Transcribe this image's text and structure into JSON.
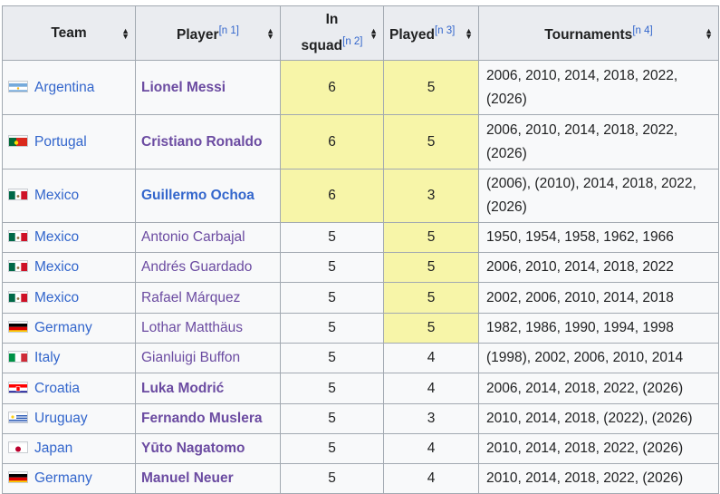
{
  "headers": {
    "team": "Team",
    "player": "Player",
    "player_note": "[n 1]",
    "squad_line1": "In",
    "squad_line2": "squad",
    "squad_note": "[n 2]",
    "played": "Played",
    "played_note": "[n 3]",
    "tournaments": "Tournaments",
    "tournaments_note": "[n 4]"
  },
  "colors": {
    "highlight": "#f7f5a8",
    "link": "#3366cc",
    "visited": "#6b4ba1",
    "header_bg": "#eaecf0"
  },
  "rows": [
    {
      "team": "Argentina",
      "flag": "argentina-flag-icon",
      "player": "Lionel Messi",
      "squad": "6",
      "played": "5",
      "tournaments": "2006, 2010, 2014, 2018, 2022, (2026)"
    },
    {
      "team": "Portugal",
      "flag": "portugal-flag-icon",
      "player": "Cristiano Ronaldo",
      "squad": "6",
      "played": "5",
      "tournaments": "2006, 2010, 2014, 2018, 2022, (2026)"
    },
    {
      "team": "Mexico",
      "flag": "mexico-flag-icon",
      "player": "Guillermo Ochoa",
      "squad": "6",
      "played": "3",
      "tournaments": "(2006), (2010), 2014, 2018, 2022, (2026)"
    },
    {
      "team": "Mexico",
      "flag": "mexico-flag-icon",
      "player": "Antonio Carbajal",
      "squad": "5",
      "played": "5",
      "tournaments": "1950, 1954, 1958, 1962, 1966"
    },
    {
      "team": "Mexico",
      "flag": "mexico-flag-icon",
      "player": "Andrés Guardado",
      "squad": "5",
      "played": "5",
      "tournaments": "2006, 2010, 2014, 2018, 2022"
    },
    {
      "team": "Mexico",
      "flag": "mexico-flag-icon",
      "player": "Rafael Márquez",
      "squad": "5",
      "played": "5",
      "tournaments": "2002, 2006, 2010, 2014, 2018"
    },
    {
      "team": "Germany",
      "flag": "germany-flag-icon",
      "player": "Lothar Matthäus",
      "squad": "5",
      "played": "5",
      "tournaments": "1982, 1986, 1990, 1994, 1998"
    },
    {
      "team": "Italy",
      "flag": "italy-flag-icon",
      "player": "Gianluigi Buffon",
      "squad": "5",
      "played": "4",
      "tournaments": "(1998), 2002, 2006, 2010, 2014"
    },
    {
      "team": "Croatia",
      "flag": "croatia-flag-icon",
      "player": "Luka Modrić",
      "squad": "5",
      "played": "4",
      "tournaments": "2006, 2014, 2018, 2022, (2026)"
    },
    {
      "team": "Uruguay",
      "flag": "uruguay-flag-icon",
      "player": "Fernando Muslera",
      "squad": "5",
      "played": "3",
      "tournaments": "2010, 2014, 2018, (2022), (2026)"
    },
    {
      "team": "Japan",
      "flag": "japan-flag-icon",
      "player": "Yūto Nagatomo",
      "squad": "5",
      "played": "4",
      "tournaments": "2010, 2014, 2018, 2022, (2026)"
    },
    {
      "team": "Germany",
      "flag": "germany-flag-icon",
      "player": "Manuel Neuer",
      "squad": "5",
      "played": "4",
      "tournaments": "2010, 2014, 2018, 2022, (2026)"
    }
  ]
}
